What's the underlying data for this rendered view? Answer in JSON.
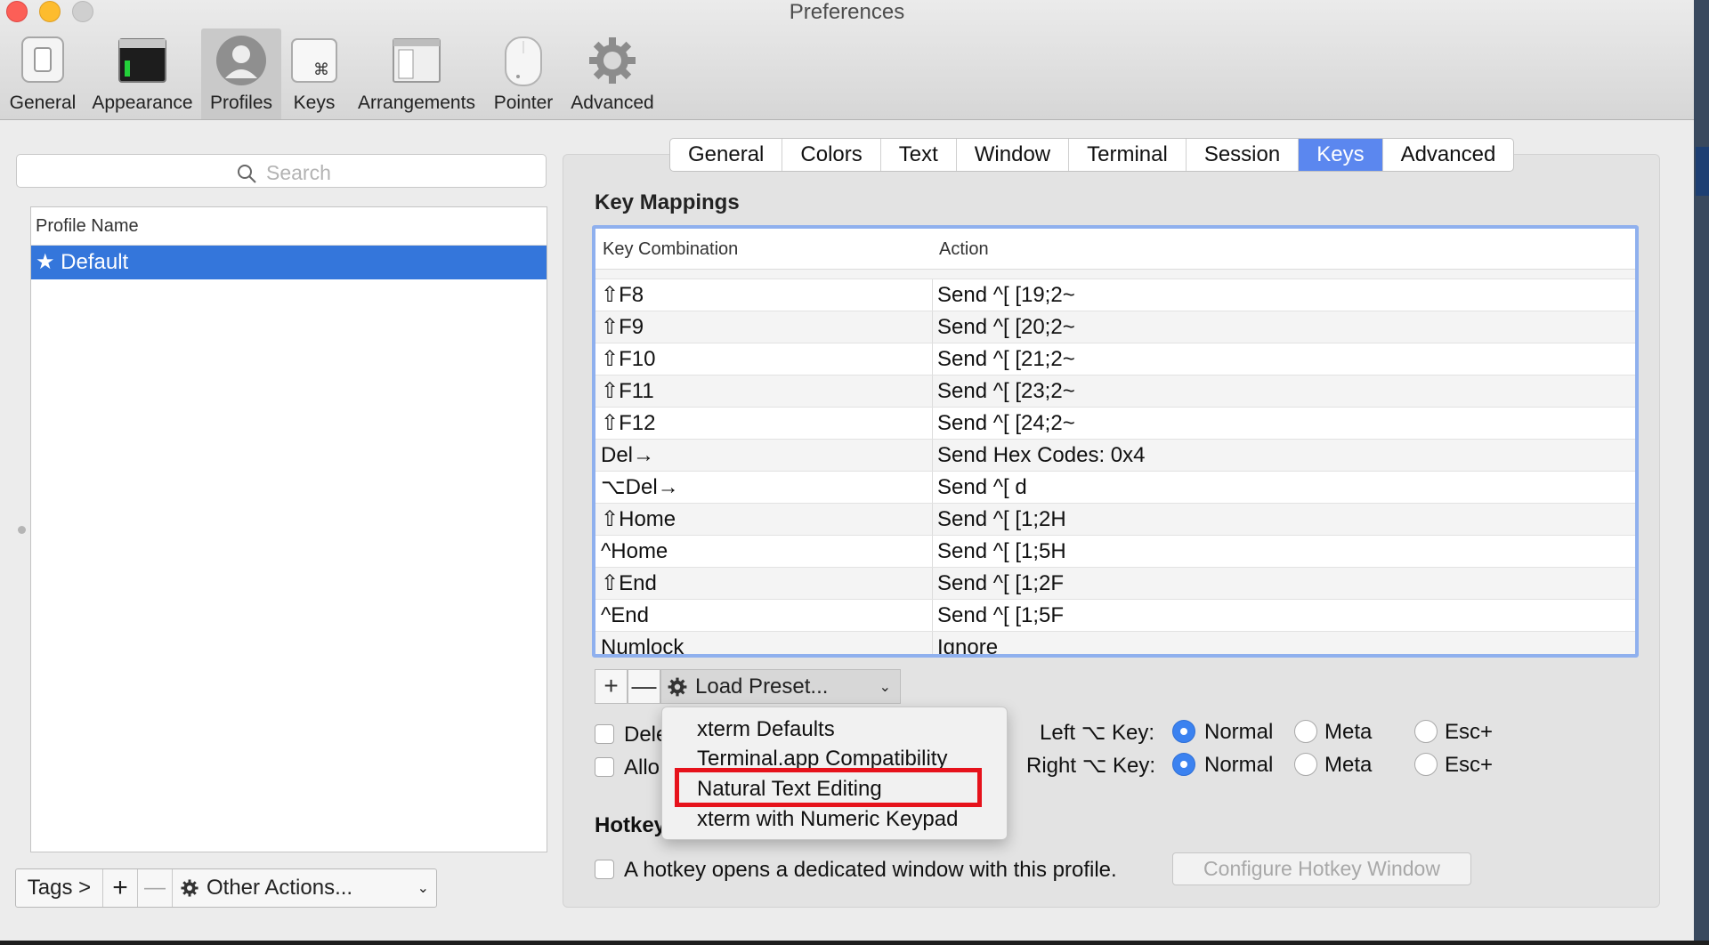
{
  "window": {
    "title": "Preferences"
  },
  "toolbar": {
    "items": [
      {
        "label": "General",
        "icon": "switch-icon"
      },
      {
        "label": "Appearance",
        "icon": "terminal-window-icon"
      },
      {
        "label": "Profiles",
        "icon": "user-silhouette-icon",
        "selected": true
      },
      {
        "label": "Keys",
        "icon": "command-key-icon"
      },
      {
        "label": "Arrangements",
        "icon": "window-arrangement-icon"
      },
      {
        "label": "Pointer",
        "icon": "mouse-icon"
      },
      {
        "label": "Advanced",
        "icon": "gear-icon"
      }
    ]
  },
  "left": {
    "search_placeholder": "Search",
    "column_header": "Profile Name",
    "profiles": [
      {
        "name": "★ Default",
        "selected": true
      }
    ],
    "bottom": {
      "tags": "Tags >",
      "add": "+",
      "remove": "—",
      "other_actions": "Other Actions..."
    }
  },
  "tabs": [
    {
      "label": "General"
    },
    {
      "label": "Colors"
    },
    {
      "label": "Text"
    },
    {
      "label": "Window"
    },
    {
      "label": "Terminal"
    },
    {
      "label": "Session"
    },
    {
      "label": "Keys",
      "active": true
    },
    {
      "label": "Advanced"
    }
  ],
  "key_mappings": {
    "title": "Key Mappings",
    "columns": [
      "Key Combination",
      "Action"
    ],
    "rows": [
      {
        "key": "⇧F8",
        "action": "Send ^[ [19;2~"
      },
      {
        "key": "⇧F9",
        "action": "Send ^[ [20;2~"
      },
      {
        "key": "⇧F10",
        "action": "Send ^[ [21;2~"
      },
      {
        "key": "⇧F11",
        "action": "Send ^[ [23;2~"
      },
      {
        "key": "⇧F12",
        "action": "Send ^[ [24;2~"
      },
      {
        "key": "Del→",
        "action": "Send Hex Codes: 0x4"
      },
      {
        "key": "⌥Del→",
        "action": "Send ^[ d"
      },
      {
        "key": "⇧Home",
        "action": "Send ^[ [1;2H"
      },
      {
        "key": "^Home",
        "action": "Send ^[ [1;5H"
      },
      {
        "key": "⇧End",
        "action": "Send ^[ [1;2F"
      },
      {
        "key": "^End",
        "action": "Send ^[ [1;5F"
      },
      {
        "key": "Numlock",
        "action": "Ignore"
      }
    ],
    "add": "+",
    "remove": "—",
    "load_preset": "Load Preset..."
  },
  "options": {
    "check1_partial": "Dele",
    "check2_partial": "Allo",
    "left_key_label": "Left ⌥ Key:",
    "right_key_label": "Right ⌥ Key:",
    "radio_labels": [
      "Normal",
      "Meta",
      "Esc+"
    ],
    "left_selected": "Normal",
    "right_selected": "Normal"
  },
  "hotkey": {
    "title_partial": "Hotkey",
    "checkbox_label": "A hotkey opens a dedicated window with this profile.",
    "configure_button": "Configure Hotkey Window"
  },
  "preset_menu": {
    "items": [
      "xterm Defaults",
      "Terminal.app Compatibility",
      "Natural Text Editing",
      "xterm with Numeric Keypad"
    ],
    "highlighted": "Natural Text Editing"
  },
  "colors": {
    "selection": "#3476db",
    "tab_active": "#5b87ef",
    "highlight_box": "#e6121b"
  }
}
